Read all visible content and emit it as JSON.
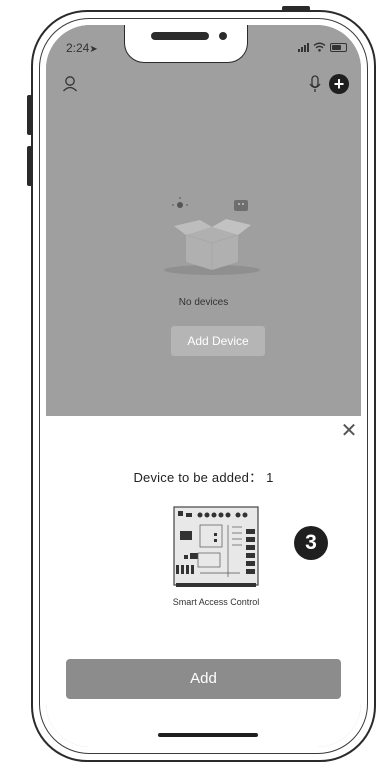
{
  "status_bar": {
    "time": "2:24"
  },
  "home": {
    "empty_text": "No devices",
    "add_device_label": "Add Device"
  },
  "sheet": {
    "title": "Device to be added： 1",
    "device_name": "Smart Access Control",
    "step_number": "3",
    "add_label": "Add"
  },
  "icons": {
    "profile": "user-icon",
    "voice": "microphone-icon",
    "add": "plus-icon",
    "close": "close-icon"
  },
  "colors": {
    "overlay": "#9f9f9f",
    "add_button": "#8c8c8c",
    "badge": "#1f1f1f"
  }
}
